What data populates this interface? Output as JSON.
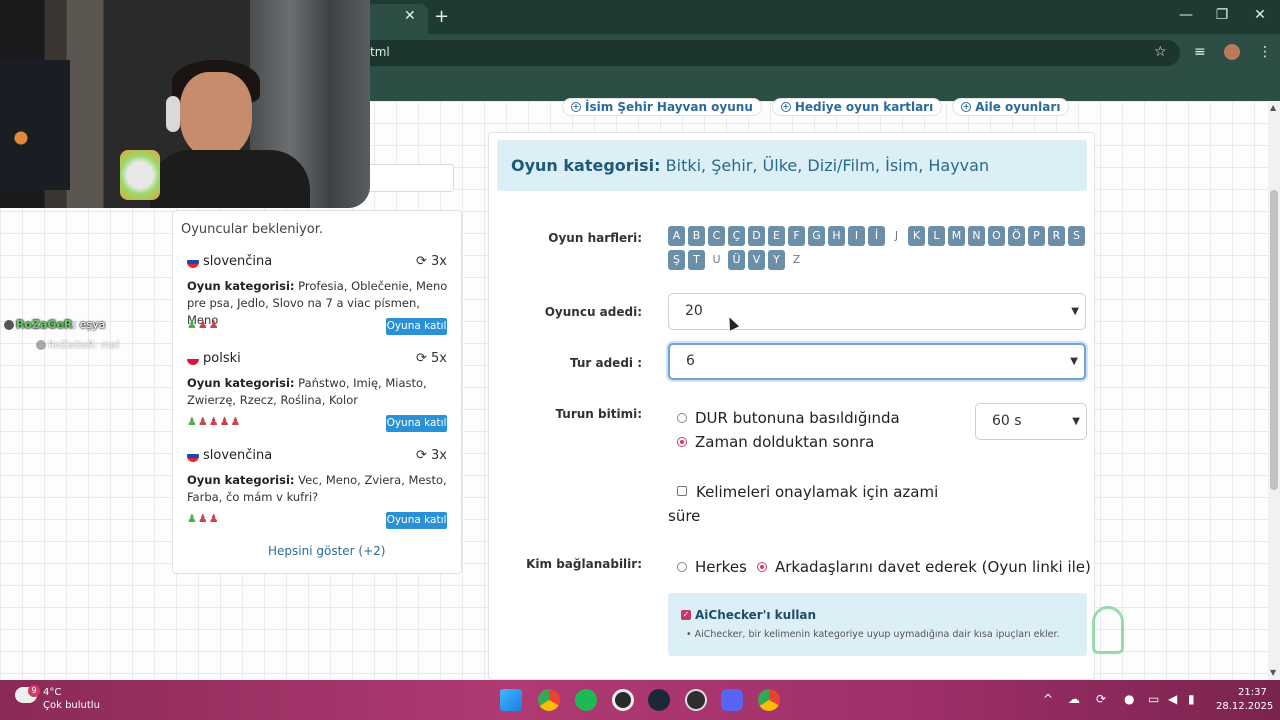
{
  "browser": {
    "tab_close": "✕",
    "new_tab": "+",
    "url_fragment": "tml",
    "window_controls": {
      "minimize": "—",
      "maximize": "❐",
      "close": "✕"
    },
    "toolbar_icons": [
      "star-icon",
      "media-icon",
      "profile-avatar",
      "menu-icon"
    ]
  },
  "top_links": [
    {
      "label": "İsim Şehir Hayvan oyunu"
    },
    {
      "label": "Hediye oyun kartları"
    },
    {
      "label": "Aile oyunları"
    }
  ],
  "sidebar": {
    "waiting_title": "Oyuncular bekleniyor.",
    "games": [
      {
        "language": "slovenčina",
        "flag": "sk",
        "rounds": "3x",
        "category_label": "Oyun kategorisi:",
        "categories": "Profesia, Oblečenie, Meno pre psa, Jedlo, Slovo na 7 a viac písmen, Meno",
        "players_green": "♟",
        "players_red": "♟♟",
        "join_label": "Oyuna katıl"
      },
      {
        "language": "polski",
        "flag": "pl",
        "rounds": "5x",
        "category_label": "Oyun kategorisi:",
        "categories": "Państwo, Imię, Miasto, Zwierzę, Rzecz, Roślina, Kolor",
        "players_green": "♟",
        "players_red": "♟♟♟♟",
        "join_label": "Oyuna katıl"
      },
      {
        "language": "slovenčina",
        "flag": "sk",
        "rounds": "3x",
        "category_label": "Oyun kategorisi:",
        "categories": "Vec, Meno, Zviera, Mesto, Farba, čo mám v kufri?",
        "players_green": "♟",
        "players_red": "♟♟",
        "join_label": "Oyuna katıl"
      }
    ],
    "show_all": "Hepsini göster (+2)"
  },
  "chat": {
    "user": "RoZaGeR",
    "message": ": eşya",
    "user2": "RoZaGeR",
    "message2": ": mal"
  },
  "main": {
    "category_label": "Oyun kategorisi:",
    "categories": "Bitki, Şehir, Ülke, Dizi/Film, İsim, Hayvan",
    "letters_label": "Oyun harfleri:",
    "letters": [
      {
        "l": "A",
        "on": true
      },
      {
        "l": "B",
        "on": true
      },
      {
        "l": "C",
        "on": true
      },
      {
        "l": "Ç",
        "on": true
      },
      {
        "l": "D",
        "on": true
      },
      {
        "l": "E",
        "on": true
      },
      {
        "l": "F",
        "on": true
      },
      {
        "l": "G",
        "on": true
      },
      {
        "l": "H",
        "on": true
      },
      {
        "l": "I",
        "on": true
      },
      {
        "l": "İ",
        "on": true
      },
      {
        "l": "J",
        "on": false
      },
      {
        "l": "K",
        "on": true
      },
      {
        "l": "L",
        "on": true
      },
      {
        "l": "M",
        "on": true
      },
      {
        "l": "N",
        "on": true
      },
      {
        "l": "O",
        "on": true
      },
      {
        "l": "Ö",
        "on": true
      },
      {
        "l": "P",
        "on": true
      },
      {
        "l": "R",
        "on": true
      },
      {
        "l": "S",
        "on": true
      },
      {
        "l": "Ş",
        "on": true
      },
      {
        "l": "T",
        "on": true
      },
      {
        "l": "U",
        "on": false
      },
      {
        "l": "Ü",
        "on": true
      },
      {
        "l": "V",
        "on": true
      },
      {
        "l": "Y",
        "on": true
      },
      {
        "l": "Z",
        "on": false
      }
    ],
    "player_count_label": "Oyuncu adedi:",
    "player_count_value": "20",
    "round_count_label": "Tur adedi :",
    "round_count_value": "6",
    "round_end_label": "Turun bitimi:",
    "round_end_options": {
      "stop_button": "DUR butonuna basıldığında",
      "time_up": "Zaman dolduktan sonra",
      "selected": "time_up"
    },
    "time_value": "60 s",
    "approve_time_label": "Kelimeleri onaylamak için azami süre",
    "approve_time_checked": false,
    "who_can_join_label": "Kim bağlanabilir:",
    "who_can_join_options": {
      "everyone": "Herkes",
      "friends": "Arkadaşlarını davet ederek (Oyun linki ile)",
      "selected": "friends"
    },
    "aichecker_label": "AiChecker'ı kullan",
    "aichecker_checked": true,
    "aichecker_desc": "AiChecker, bir kelimenin kategoriye uyup uymadığına dair kısa ipuçları ekler."
  },
  "taskbar": {
    "weather_badge": "9",
    "temperature": "4°C",
    "weather": "Çok bulutlu",
    "time": "21:37",
    "date": "28.12.2025",
    "apps": [
      "windows-start-icon",
      "chrome-icon",
      "spotify-icon",
      "steam-settings-icon",
      "steam-icon",
      "obs-icon",
      "discord-icon",
      "chrome-profile-icon"
    ]
  },
  "colors": {
    "accent": "#2a91d6",
    "category_bg": "#dceff7",
    "letter_bg": "#6b8fa8",
    "radio_selected": "#d33a64",
    "browser_chrome": "#2d4e45"
  }
}
